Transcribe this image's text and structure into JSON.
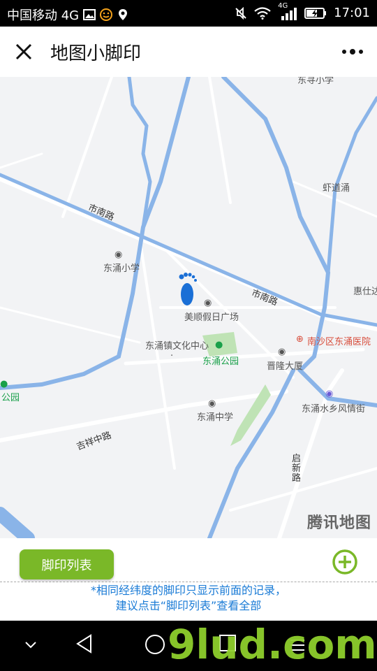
{
  "status_bar": {
    "carrier": "中国移动 4G",
    "time": "17:01",
    "network_label": "4G",
    "icons": [
      "image-icon",
      "emoji-icon",
      "location-icon",
      "mute-icon",
      "wifi-icon",
      "signal-icon",
      "battery-charging-icon"
    ]
  },
  "header": {
    "title": "地图小脚印",
    "close_icon": "close-icon",
    "more_icon": "more-dots-icon"
  },
  "map": {
    "labels": {
      "shinan_road_1": "市南路",
      "shinan_road_2": "市南路",
      "dongyong_primary": "东涌小学",
      "meishun_plaza": "美顺假日广场",
      "culture_center": "东涌镇文化中心",
      "dongyong_park": "东涌公园",
      "hospital": "南沙区东涌医院",
      "jinlong_building": "晋隆大厦",
      "dongyong_middle": "东涌中学",
      "watertown_street": "东涌水乡风情街",
      "jixiang_road": "吉祥中路",
      "qixin_road": "启新路",
      "xiadao_yong": "虾道涌",
      "huishi": "惠仕达",
      "left_park": "公园",
      "top_label": "东寻小学",
      "watermark": "腾讯地图"
    },
    "colors": {
      "water": "#8ab4e8",
      "park": "#bfe3b5",
      "footprint": "#1a6fd6"
    }
  },
  "bottom": {
    "list_button": "脚印列表",
    "add_icon": "plus-circle-icon",
    "note_line1": "*相同经纬度的脚印只显示前面的记录，",
    "note_line2": "建议点击“脚印列表”查看全部",
    "accent": "#7ab828"
  },
  "nav_bar": {
    "back_icon": "back-triangle-icon",
    "home_icon": "home-circle-icon",
    "recent_icon": "recent-square-icon",
    "menu_icon": "menu-icon",
    "down_icon": "chevron-down-icon",
    "watermark": "9lud.com"
  }
}
